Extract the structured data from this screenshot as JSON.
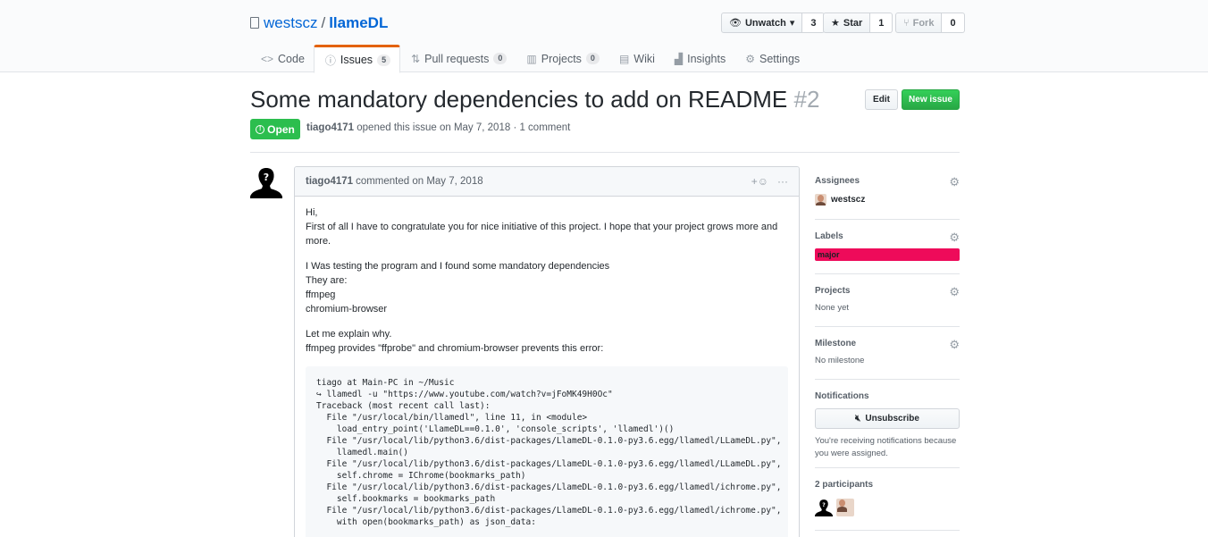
{
  "repo": {
    "owner": "westscz",
    "separator": "/",
    "name": "llameDL"
  },
  "repo_actions": {
    "watch": {
      "label": "Unwatch",
      "count": "3"
    },
    "star": {
      "label": "Star",
      "count": "1"
    },
    "fork": {
      "label": "Fork",
      "count": "0"
    }
  },
  "tabs": [
    {
      "label": "Code",
      "icon": "code-icon"
    },
    {
      "label": "Issues",
      "icon": "issue-opened-icon",
      "count": "5"
    },
    {
      "label": "Pull requests",
      "icon": "git-pull-request-icon",
      "count": "0"
    },
    {
      "label": "Projects",
      "icon": "project-icon",
      "count": "0"
    },
    {
      "label": "Wiki",
      "icon": "book-icon"
    },
    {
      "label": "Insights",
      "icon": "graph-icon"
    },
    {
      "label": "Settings",
      "icon": "gear-icon"
    }
  ],
  "issue": {
    "title": "Some mandatory dependencies to add on README",
    "number": "#2",
    "edit_label": "Edit",
    "new_issue_label": "New issue",
    "state": "Open",
    "author": "tiago4171",
    "opened_text": "opened this issue on May 7, 2018 · 1 comment"
  },
  "comment": {
    "author": "tiago4171",
    "meta": "commented on May 7, 2018",
    "paragraphs": [
      [
        "Hi,",
        "First of all I have to congratulate you for nice initiative of this project. I hope that your project grows more and more."
      ],
      [
        "I Was testing the program and I found some mandatory dependencies",
        "They are:",
        "ffmpeg",
        "chromium-browser"
      ],
      [
        "Let me explain why.",
        "ffmpeg provides \"ffprobe\" and chromium-browser prevents this error:"
      ]
    ],
    "code": "tiago at Main-PC in ~/Music\n↪ llamedl -u \"https://www.youtube.com/watch?v=jFoMK49H0Oc\"\nTraceback (most recent call last):\n  File \"/usr/local/bin/llamedl\", line 11, in <module>\n    load_entry_point('LlameDL==0.1.0', 'console_scripts', 'llamedl')()\n  File \"/usr/local/lib/python3.6/dist-packages/LlameDL-0.1.0-py3.6.egg/llamedl/LLameDL.py\",\n    llamedl.main()\n  File \"/usr/local/lib/python3.6/dist-packages/LlameDL-0.1.0-py3.6.egg/llamedl/LLameDL.py\",\n    self.chrome = IChrome(bookmarks_path)\n  File \"/usr/local/lib/python3.6/dist-packages/LlameDL-0.1.0-py3.6.egg/llamedl/ichrome.py\",\n    self.bookmarks = bookmarks_path\n  File \"/usr/local/lib/python3.6/dist-packages/LlameDL-0.1.0-py3.6.egg/llamedl/ichrome.py\",\n    with open(bookmarks_path) as json_data:"
  },
  "sidebar": {
    "assignees": {
      "heading": "Assignees",
      "value": "westscz"
    },
    "labels": {
      "heading": "Labels",
      "value": "major",
      "color": "#ee0b5a"
    },
    "projects": {
      "heading": "Projects",
      "value": "None yet"
    },
    "milestone": {
      "heading": "Milestone",
      "value": "No milestone"
    },
    "notifications": {
      "heading": "Notifications",
      "button": "Unsubscribe",
      "text": "You're receiving notifications because you were assigned."
    },
    "participants": {
      "heading": "2 participants"
    }
  },
  "colors": {
    "open_state": "#2cbe4e",
    "link": "#0366d6",
    "selected_tab_accent": "#e36209"
  }
}
